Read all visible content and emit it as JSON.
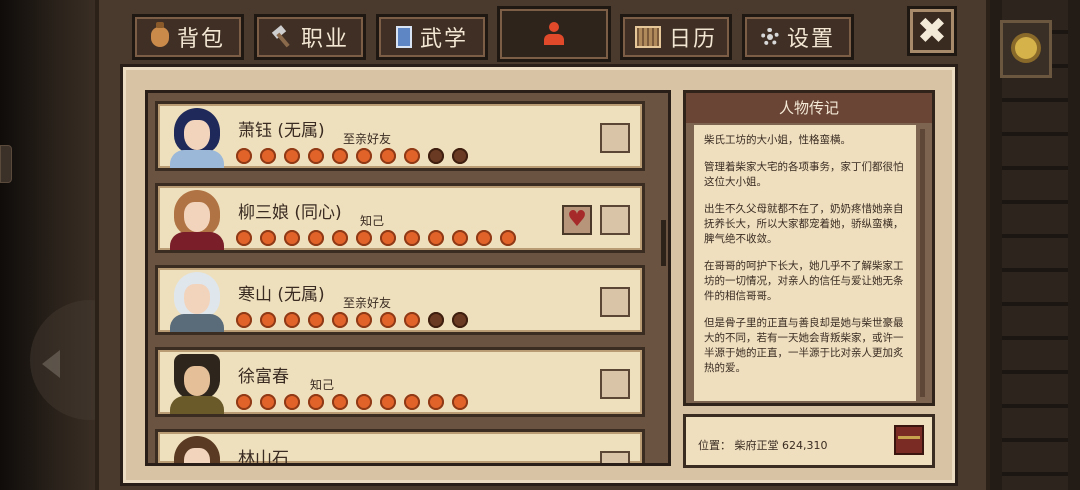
{
  "tabs": [
    {
      "label": "背包",
      "icon": "bag-icon"
    },
    {
      "label": "职业",
      "icon": "hammer-icon"
    },
    {
      "label": "武学",
      "icon": "book-icon"
    },
    {
      "label": "",
      "icon": "person-icon"
    },
    {
      "label": "日历",
      "icon": "calendar-icon"
    },
    {
      "label": "设置",
      "icon": "gear-icon"
    }
  ],
  "close_label": "✖",
  "characters": [
    {
      "name": "萧钰 (无属)",
      "relation": "至亲好友",
      "affection": 8,
      "max": 10
    },
    {
      "name": "柳三娘 (同心)",
      "relation": "知己",
      "affection": 12,
      "max": 12
    },
    {
      "name": "寒山 (无属)",
      "relation": "至亲好友",
      "affection": 8,
      "max": 10
    },
    {
      "name": "徐富春",
      "relation": "知己",
      "affection": 10,
      "max": 10
    },
    {
      "name": "林山石",
      "relation": "",
      "affection": 0,
      "max": 0
    }
  ],
  "bio": {
    "title": "人物传记",
    "paragraphs": [
      "柴氏工坊的大小姐，性格蛮横。",
      "管理着柴家大宅的各项事务，家丁们都很怕这位大小姐。",
      "出生不久父母就都不在了，奶奶疼惜她亲自抚养长大，所以大家都宠着她，骄纵蛮横，脾气绝不收敛。",
      "在哥哥的呵护下长大，她几乎不了解柴家工坊的一切情况，对亲人的信任与爱让她无条件的相信哥哥。",
      "但是骨子里的正直与善良却是她与柴世豪最大的不同，若有一天她会背叛柴家，或许一半源于她的正直，一半源于比对亲人更加炙热的爱。"
    ]
  },
  "location": {
    "text": "位置：  柴府正堂 624,310"
  },
  "colors": {
    "accent_dot": "#e2632a",
    "dot_empty": "#6b3a22",
    "panel": "#efe0bd",
    "heart": "#a72a2a"
  }
}
